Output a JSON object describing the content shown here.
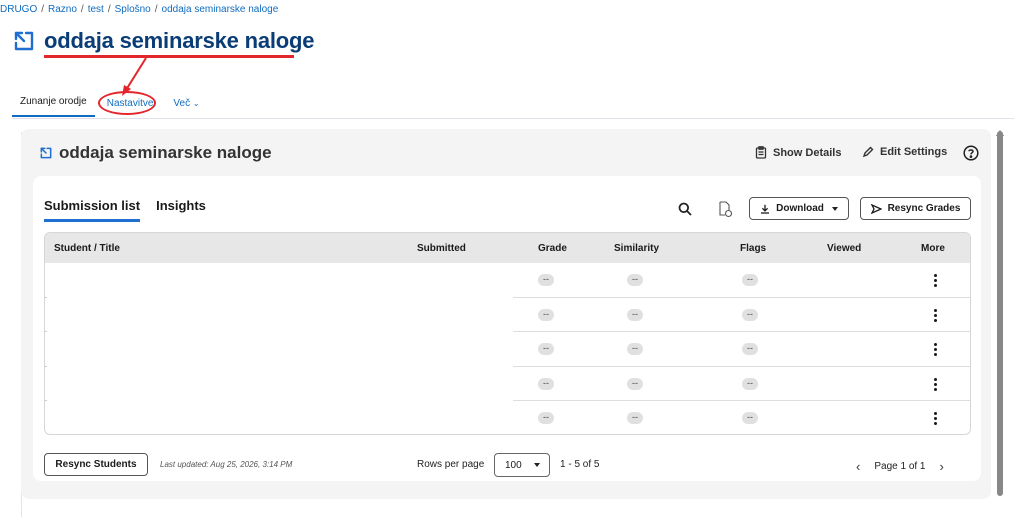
{
  "breadcrumb": {
    "items": [
      "DRUGO",
      "Razno",
      "test",
      "Splošno",
      "oddaja seminarske naloge"
    ],
    "separator": "/"
  },
  "page": {
    "title": "oddaja seminarske naloge",
    "icon": "external-tool-icon"
  },
  "nav_tabs": [
    {
      "label": "Zunanje orodje",
      "active": true
    },
    {
      "label": "Nastavitve",
      "active": false
    },
    {
      "label": "Več",
      "active": false
    }
  ],
  "panel": {
    "title": "oddaja seminarske naloge",
    "show_details_label": "Show Details",
    "edit_settings_label": "Edit Settings",
    "help_icon": "help-icon"
  },
  "inbox": {
    "tabs": [
      "Submission list",
      "Insights"
    ],
    "download_label": "Download",
    "resync_grades_label": "Resync Grades",
    "columns": [
      "Student / Title",
      "Submitted",
      "Grade",
      "Similarity",
      "Flags",
      "Viewed",
      "More"
    ],
    "rows": [
      {
        "grade": "--",
        "similarity": "--",
        "flags": "--"
      },
      {
        "grade": "--",
        "similarity": "--",
        "flags": "--"
      },
      {
        "grade": "--",
        "similarity": "--",
        "flags": "--"
      },
      {
        "grade": "--",
        "similarity": "--",
        "flags": "--"
      },
      {
        "grade": "--",
        "similarity": "--",
        "flags": "--"
      }
    ]
  },
  "footer": {
    "resync_students_label": "Resync Students",
    "last_updated": "Last updated: Aug 25, 2026, 3:14 PM",
    "rows_per_page_label": "Rows per page",
    "rows_per_page_value": "100",
    "range": "1 - 5 of 5",
    "page_label": "Page 1 of 1"
  },
  "annotations": {
    "color": "#e3262b"
  },
  "colors": {
    "brand": "#0a3d75",
    "accent": "#1f6fd1",
    "link": "#0f6cbf"
  }
}
